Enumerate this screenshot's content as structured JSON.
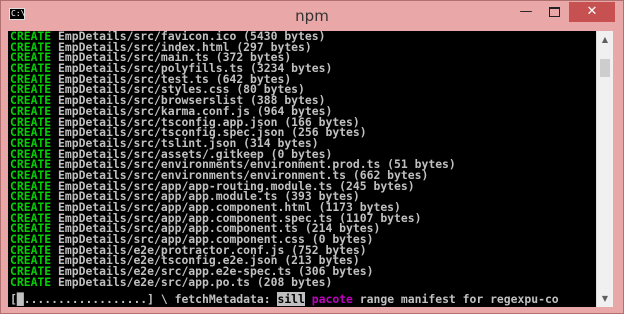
{
  "window": {
    "title": "npm",
    "icon_text": "C:\\"
  },
  "controls": {
    "minimize": "—",
    "close": "✕"
  },
  "lines": [
    {
      "kw": "CREATE",
      "text": " EmpDetails/src/favicon.ico (5430 bytes)"
    },
    {
      "kw": "CREATE",
      "text": " EmpDetails/src/index.html (297 bytes)"
    },
    {
      "kw": "CREATE",
      "text": " EmpDetails/src/main.ts (372 bytes)"
    },
    {
      "kw": "CREATE",
      "text": " EmpDetails/src/polyfills.ts (3234 bytes)"
    },
    {
      "kw": "CREATE",
      "text": " EmpDetails/src/test.ts (642 bytes)"
    },
    {
      "kw": "CREATE",
      "text": " EmpDetails/src/styles.css (80 bytes)"
    },
    {
      "kw": "CREATE",
      "text": " EmpDetails/src/browserslist (388 bytes)"
    },
    {
      "kw": "CREATE",
      "text": " EmpDetails/src/karma.conf.js (964 bytes)"
    },
    {
      "kw": "CREATE",
      "text": " EmpDetails/src/tsconfig.app.json (166 bytes)"
    },
    {
      "kw": "CREATE",
      "text": " EmpDetails/src/tsconfig.spec.json (256 bytes)"
    },
    {
      "kw": "CREATE",
      "text": " EmpDetails/src/tslint.json (314 bytes)"
    },
    {
      "kw": "CREATE",
      "text": " EmpDetails/src/assets/.gitkeep (0 bytes)"
    },
    {
      "kw": "CREATE",
      "text": " EmpDetails/src/environments/environment.prod.ts (51 bytes)"
    },
    {
      "kw": "CREATE",
      "text": " EmpDetails/src/environments/environment.ts (662 bytes)"
    },
    {
      "kw": "CREATE",
      "text": " EmpDetails/src/app/app-routing.module.ts (245 bytes)"
    },
    {
      "kw": "CREATE",
      "text": " EmpDetails/src/app/app.module.ts (393 bytes)"
    },
    {
      "kw": "CREATE",
      "text": " EmpDetails/src/app/app.component.html (1173 bytes)"
    },
    {
      "kw": "CREATE",
      "text": " EmpDetails/src/app/app.component.spec.ts (1107 bytes)"
    },
    {
      "kw": "CREATE",
      "text": " EmpDetails/src/app/app.component.ts (214 bytes)"
    },
    {
      "kw": "CREATE",
      "text": " EmpDetails/src/app/app.component.css (0 bytes)"
    },
    {
      "kw": "CREATE",
      "text": " EmpDetails/e2e/protractor.conf.js (752 bytes)"
    },
    {
      "kw": "CREATE",
      "text": " EmpDetails/e2e/tsconfig.e2e.json (213 bytes)"
    },
    {
      "kw": "CREATE",
      "text": " EmpDetails/e2e/src/app.e2e-spec.ts (306 bytes)"
    },
    {
      "kw": "CREATE",
      "text": " EmpDetails/e2e/src/app.po.ts (208 bytes)"
    }
  ],
  "status": {
    "progress_prefix": "[",
    "progress_cursor": "█",
    "progress_dots": "..................] \\ fetchMetadata: ",
    "sill": "sill",
    "pacote": " pacote",
    "rest": " range manifest for regexpu-co"
  },
  "scrollbar": {
    "up": "▲",
    "down": "▼"
  },
  "colors": {
    "keyword": "#00d000",
    "console_bg": "#000000",
    "title_bar": "#eaa7a7",
    "pacote": "#c000c0"
  }
}
